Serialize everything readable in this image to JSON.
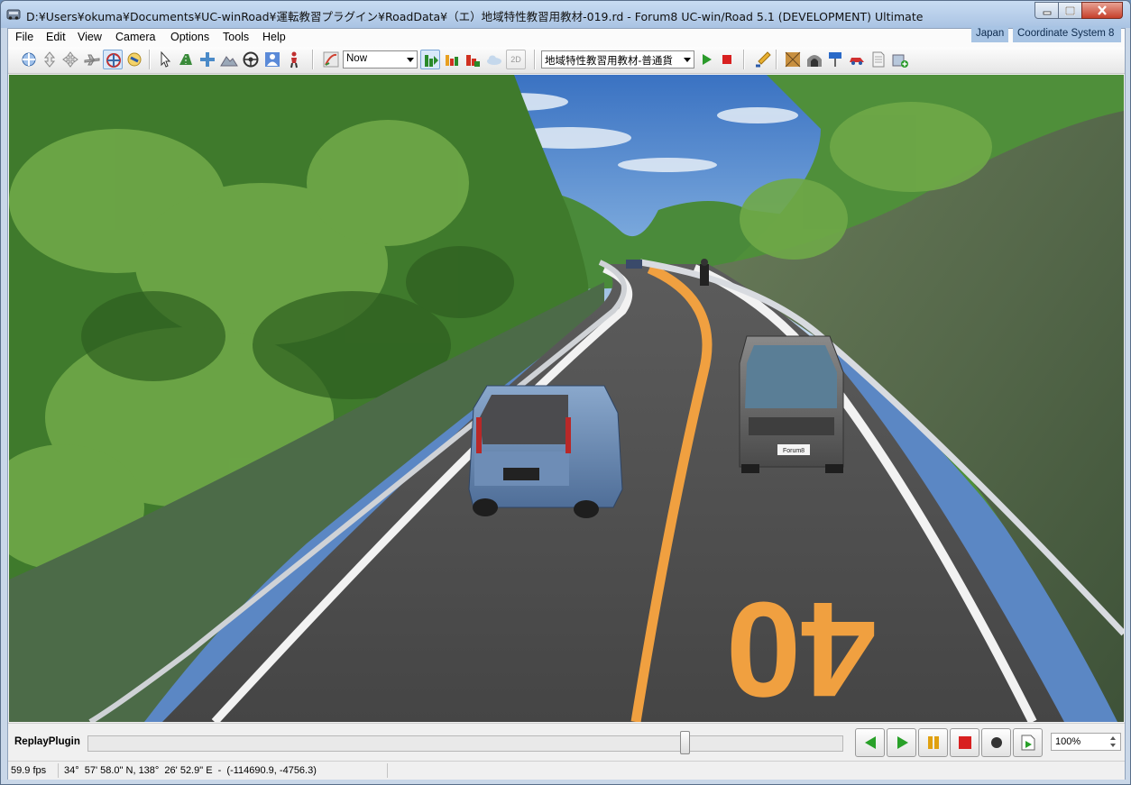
{
  "window": {
    "title": "D:¥Users¥okuma¥Documents¥UC-winRoad¥運転教習プラグイン¥RoadData¥（エ）地域特性教習用教材-019.rd - Forum8 UC-win/Road 5.1 (DEVELOPMENT) Ultimate",
    "minimize_icon": "minimize-icon",
    "maximize_icon": "maximize-icon",
    "close_icon": "close-icon"
  },
  "menu": {
    "items": [
      "File",
      "Edit",
      "View",
      "Camera",
      "Options",
      "Tools",
      "Help"
    ],
    "region_tag": "Japan",
    "coordinate_tag": "Coordinate System 8"
  },
  "toolbar": {
    "time_combo": "Now",
    "scenario_combo": "地域特性教習用教材-普通貨",
    "view_2d_label": "2D"
  },
  "scene": {
    "road_marking": "40",
    "car_plate": "Forum8"
  },
  "replay": {
    "label": "ReplayPlugin",
    "zoom": "100%",
    "position": 0.795,
    "icons": [
      "step-back-icon",
      "play-icon",
      "pause-icon",
      "stop-icon",
      "record-icon",
      "export-play-icon"
    ]
  },
  "status": {
    "fps": "59.9 fps",
    "coords": "34°  57' 58.0\" N, 138°  26' 52.9\" E  -  (-114690.9, -4756.3)"
  },
  "colors": {
    "title_gradient_top": "#c8dcf2",
    "close_button": "#c6402b",
    "tag_background": "#a8c4e4",
    "center_line": "#f0a040",
    "sky": "#4a7ec8"
  }
}
